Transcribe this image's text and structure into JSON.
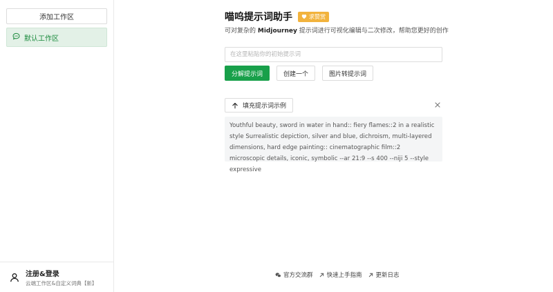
{
  "sidebar": {
    "add_workspace_label": "添加工作区",
    "workspaces": [
      {
        "label": "默认工作区",
        "active": true
      }
    ],
    "footer": {
      "title": "注册&登录",
      "subtitle": "云端工作区&自定义词典【新】"
    }
  },
  "header": {
    "title": "喵呜提示词助手",
    "sponsor_label": "求赞赏",
    "subtitle_prefix": "可对复杂的",
    "subtitle_brand": "Midjourney",
    "subtitle_suffix": "提示词进行可视化编辑与二次修改，帮助您更好的创作"
  },
  "input": {
    "placeholder": "在这里粘贴你的初始提示词",
    "value": ""
  },
  "actions": {
    "parse_label": "分解提示词",
    "create_label": "创建一个",
    "image_to_prompt_label": "图片转提示词"
  },
  "example": {
    "fill_label": "填充提示词示例",
    "text": "Youthful beauty, sword in water in hand:: fiery flames::2 in a realistic style Surrealistic depiction, silver and blue, dichroism, multi-layered dimensions, hard edge painting:: cinematographic film::2 microscopic details, iconic, symbolic --ar 21:9 --s 400 --niji 5 --style expressive"
  },
  "footer": {
    "links": [
      {
        "label": "官方交流群",
        "icon": "wechat-icon"
      },
      {
        "label": "快速上手指南",
        "icon": "external-link-icon"
      },
      {
        "label": "更新日志",
        "icon": "external-link-icon"
      }
    ]
  },
  "colors": {
    "primary": "#18a04a",
    "sponsor": "#f2b33d",
    "active_bg": "#e3f1e7"
  }
}
